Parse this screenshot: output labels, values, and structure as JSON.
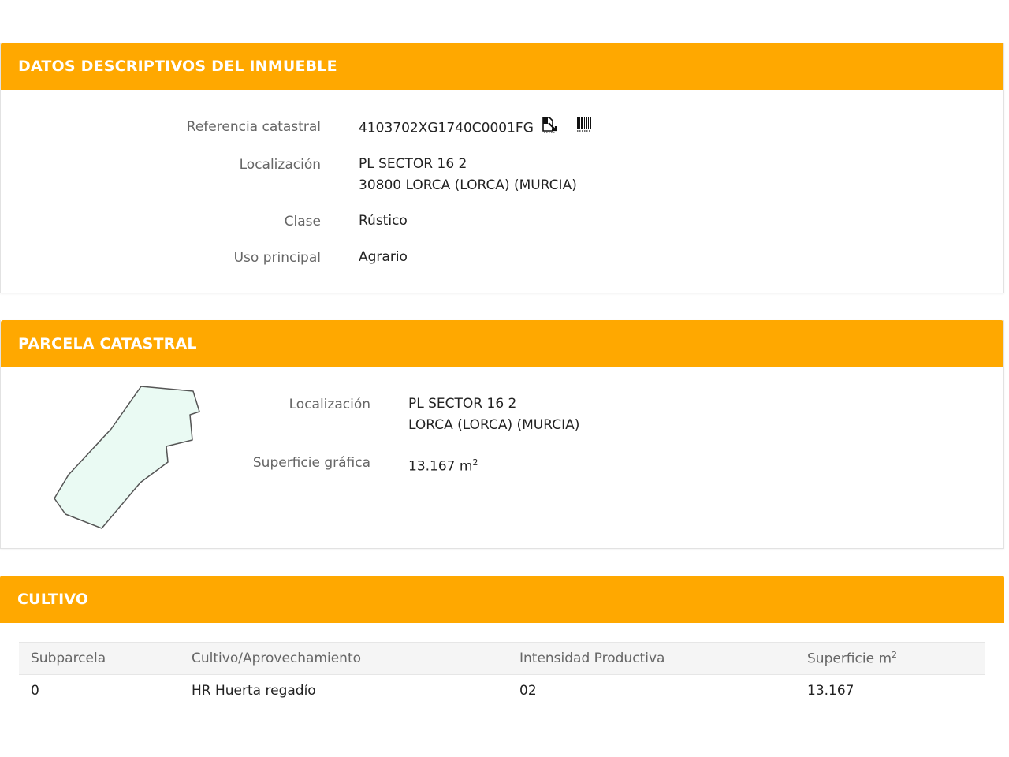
{
  "datos": {
    "title": "DATOS DESCRIPTIVOS DEL INMUEBLE",
    "ref_label": "Referencia catastral",
    "ref_value": "4103702XG1740C0001FG",
    "loc_label": "Localización",
    "loc_line1": "PL SECTOR 16 2",
    "loc_line2": "30800 LORCA (LORCA) (MURCIA)",
    "clase_label": "Clase",
    "clase_value": "Rústico",
    "uso_label": "Uso principal",
    "uso_value": "Agrario",
    "icons": [
      "copy-document-icon",
      "barcode-icon"
    ]
  },
  "parcela": {
    "title": "PARCELA CATASTRAL",
    "loc_label": "Localización",
    "loc_line1": "PL SECTOR 16 2",
    "loc_line2": "LORCA (LORCA) (MURCIA)",
    "sup_label": "Superficie gráfica",
    "sup_value": "13.167 m",
    "sup_exp": "2",
    "shape_fill": "#eafaf3",
    "shape_stroke": "#555555"
  },
  "cultivo": {
    "title": "CULTIVO",
    "headers": [
      "Subparcela",
      "Cultivo/Aprovechamiento",
      "Intensidad Productiva",
      "Superficie m"
    ],
    "header_exp": "2",
    "rows": [
      [
        "0",
        "HR Huerta regadío",
        "02",
        "13.167"
      ]
    ]
  },
  "colors": {
    "header": "#ffa800",
    "label": "#666666",
    "value": "#222222"
  }
}
